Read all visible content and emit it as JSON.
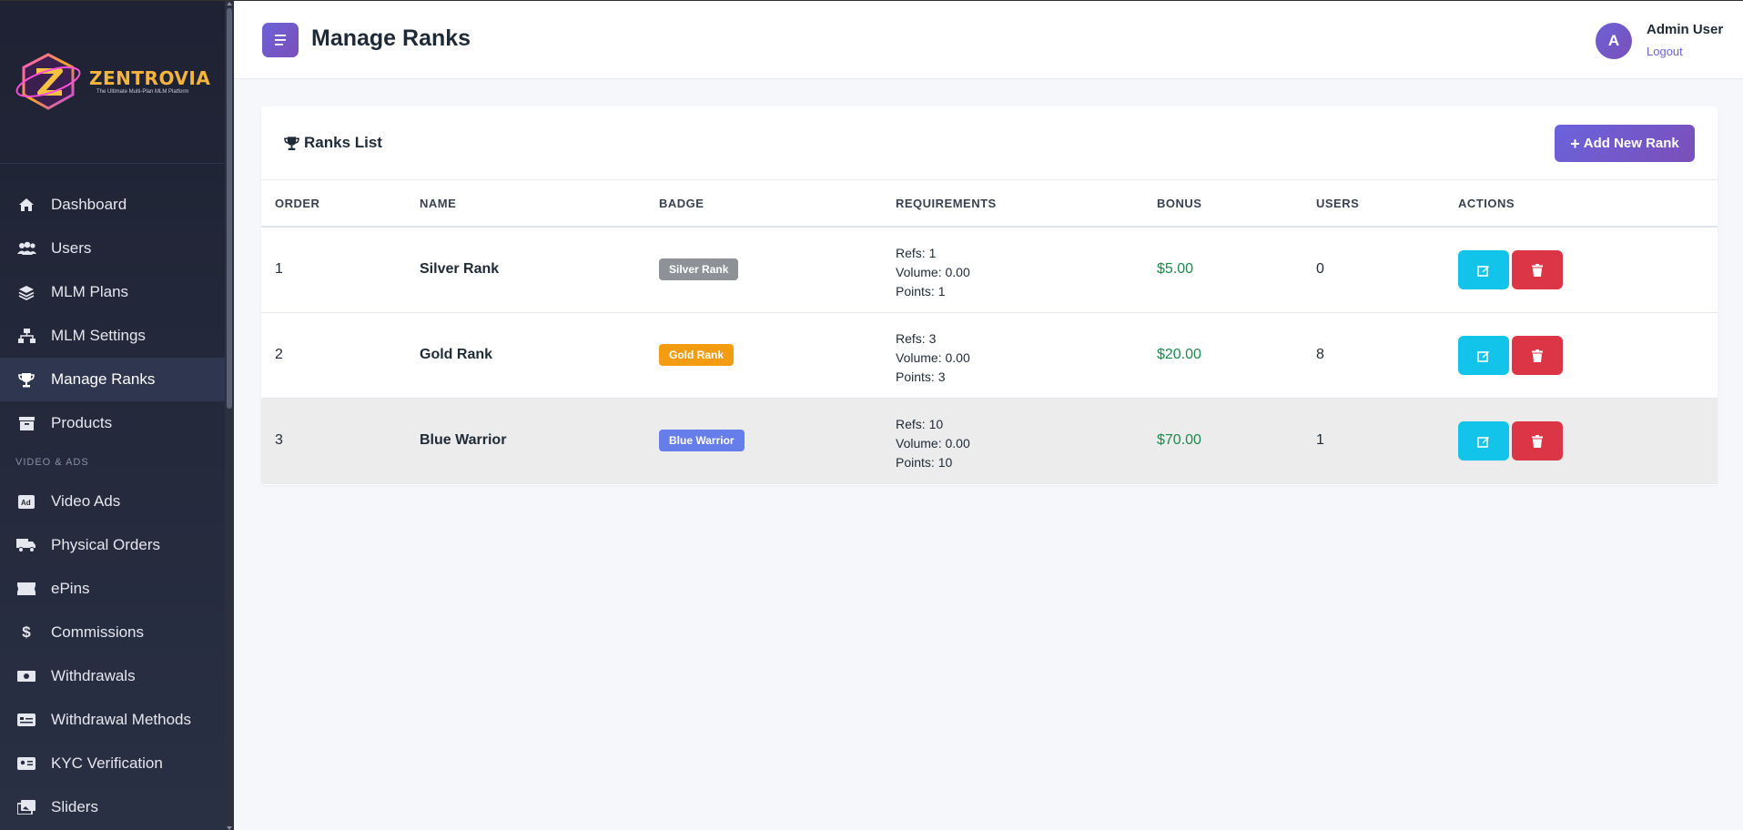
{
  "brand": {
    "name": "ZENTROVIA",
    "tagline": "The Ultimate Multi-Plan MLM Platform"
  },
  "sidebar": {
    "items": [
      {
        "label": "Dashboard",
        "icon": "home-icon"
      },
      {
        "label": "Users",
        "icon": "users-icon"
      },
      {
        "label": "MLM Plans",
        "icon": "layers-icon"
      },
      {
        "label": "MLM Settings",
        "icon": "sitemap-icon"
      },
      {
        "label": "Manage Ranks",
        "icon": "trophy-icon",
        "active": true
      },
      {
        "label": "Products",
        "icon": "box-icon"
      }
    ],
    "section_label": "VIDEO & ADS",
    "section_items": [
      {
        "label": "Video Ads",
        "icon": "ad-icon"
      },
      {
        "label": "Physical Orders",
        "icon": "truck-icon"
      },
      {
        "label": "ePins",
        "icon": "ticket-icon"
      },
      {
        "label": "Commissions",
        "icon": "dollar-icon"
      },
      {
        "label": "Withdrawals",
        "icon": "money-icon"
      },
      {
        "label": "Withdrawal Methods",
        "icon": "card-icon"
      },
      {
        "label": "KYC Verification",
        "icon": "id-card-icon"
      },
      {
        "label": "Sliders",
        "icon": "images-icon"
      }
    ]
  },
  "header": {
    "title": "Manage Ranks",
    "avatar_letter": "A",
    "user_name": "Admin User",
    "logout_label": "Logout"
  },
  "card": {
    "title": "Ranks List",
    "add_button": "Add New Rank"
  },
  "table": {
    "columns": [
      "ORDER",
      "NAME",
      "BADGE",
      "REQUIREMENTS",
      "BONUS",
      "USERS",
      "ACTIONS"
    ],
    "rows": [
      {
        "order": "1",
        "name": "Silver Rank",
        "badge": "Silver Rank",
        "badge_color": "#8e9297",
        "refs": "Refs: 1",
        "volume": "Volume: 0.00",
        "points": "Points: 1",
        "bonus": "$5.00",
        "users": "0"
      },
      {
        "order": "2",
        "name": "Gold Rank",
        "badge": "Gold Rank",
        "badge_color": "#f39c12",
        "refs": "Refs: 3",
        "volume": "Volume: 0.00",
        "points": "Points: 3",
        "bonus": "$20.00",
        "users": "8"
      },
      {
        "order": "3",
        "name": "Blue Warrior",
        "badge": "Blue Warrior",
        "badge_color": "#667eea",
        "refs": "Refs: 10",
        "volume": "Volume: 0.00",
        "points": "Points: 10",
        "bonus": "$70.00",
        "users": "1"
      }
    ]
  },
  "colors": {
    "accent": "#6c62d8",
    "edit": "#12c4ea",
    "delete": "#dc3545",
    "bonus": "#1a8a4a"
  }
}
